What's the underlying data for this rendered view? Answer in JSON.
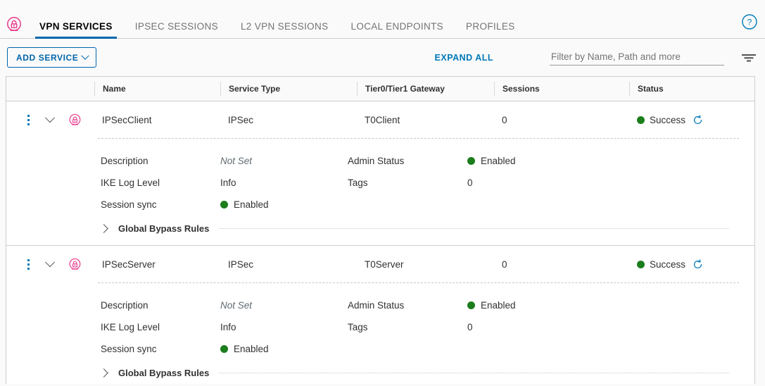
{
  "header": {
    "vpn_icon": "vpn-lock-icon",
    "help_icon": "help-circle-icon",
    "tabs": [
      {
        "label": "VPN SERVICES",
        "active": true
      },
      {
        "label": "IPSEC SESSIONS",
        "active": false
      },
      {
        "label": "L2 VPN SESSIONS",
        "active": false
      },
      {
        "label": "LOCAL ENDPOINTS",
        "active": false
      },
      {
        "label": "PROFILES",
        "active": false
      }
    ]
  },
  "toolbar": {
    "add_service_label": "ADD SERVICE",
    "add_service_caret": "chevron-down-icon",
    "expand_all_label": "EXPAND ALL",
    "filter_placeholder": "Filter by Name, Path and more",
    "filter_value": "",
    "filter_icon": "filter-funnel-icon"
  },
  "table": {
    "columns": [
      {
        "key": "actions",
        "label": ""
      },
      {
        "key": "name",
        "label": "Name"
      },
      {
        "key": "service_type",
        "label": "Service Type"
      },
      {
        "key": "gateway",
        "label": "Tier0/Tier1 Gateway"
      },
      {
        "key": "sessions",
        "label": "Sessions"
      },
      {
        "key": "status",
        "label": "Status"
      }
    ],
    "rows": [
      {
        "name": "IPSecClient",
        "service_type": "IPSec",
        "gateway": "T0Client",
        "sessions": "0",
        "status": "Success",
        "status_color": "#1b7d1b",
        "lock_icon": "vpn-lock-icon",
        "menu_icon": "kebab-menu-icon",
        "expand_icon": "chevron-down-icon",
        "refresh_icon": "refresh-icon",
        "detail": {
          "description_label": "Description",
          "description_value": "Not Set",
          "ike_log_level_label": "IKE Log Level",
          "ike_log_level_value": "Info",
          "session_sync_label": "Session sync",
          "session_sync_value": "Enabled",
          "admin_status_label": "Admin Status",
          "admin_status_value": "Enabled",
          "tags_label": "Tags",
          "tags_value": "0",
          "global_bypass_rules_label": "Global Bypass Rules"
        }
      },
      {
        "name": "IPSecServer",
        "service_type": "IPSec",
        "gateway": "T0Server",
        "sessions": "0",
        "status": "Success",
        "status_color": "#1b7d1b",
        "lock_icon": "vpn-lock-icon",
        "menu_icon": "kebab-menu-icon",
        "expand_icon": "chevron-down-icon",
        "refresh_icon": "refresh-icon",
        "detail": {
          "description_label": "Description",
          "description_value": "Not Set",
          "ike_log_level_label": "IKE Log Level",
          "ike_log_level_value": "Info",
          "session_sync_label": "Session sync",
          "session_sync_value": "Enabled",
          "admin_status_label": "Admin Status",
          "admin_status_value": "Enabled",
          "tags_label": "Tags",
          "tags_value": "0",
          "global_bypass_rules_label": "Global Bypass Rules"
        }
      }
    ]
  },
  "colors": {
    "accent_blue": "#0065ab",
    "link_blue": "#0079b8",
    "pink": "#e8388a",
    "green": "#1b7d1b"
  }
}
